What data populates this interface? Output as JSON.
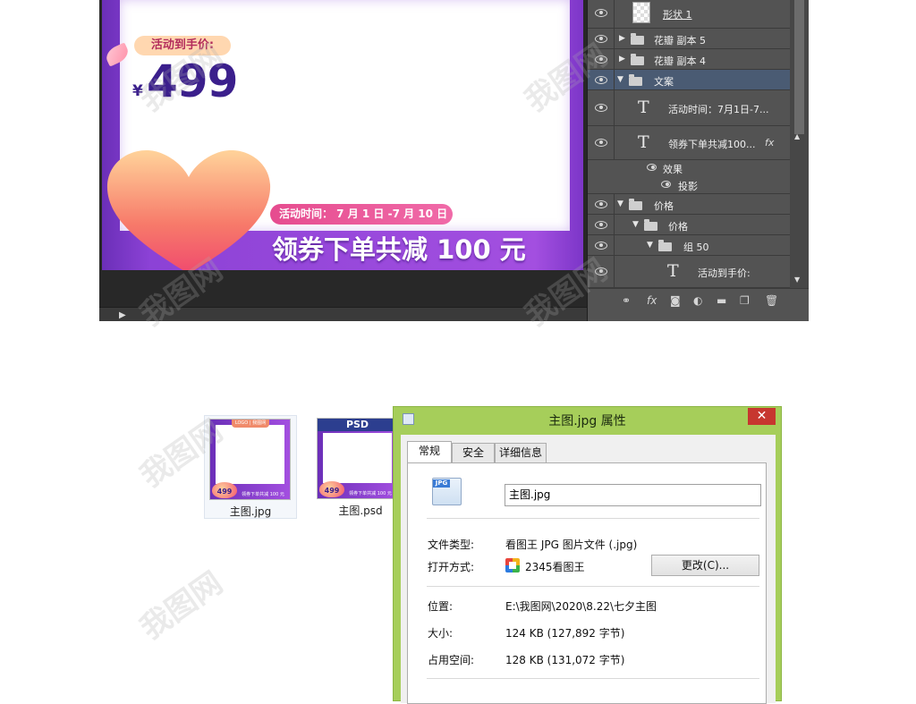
{
  "photoshop": {
    "poster": {
      "heart_label": "活动到手价:",
      "currency": "¥",
      "price": "499",
      "date_text": "活动时间：  7 月 1 日 -7 月 10 日",
      "coupon_text": "领券下单共减 100 元"
    },
    "layers": [
      {
        "name": "形状 1",
        "kind": "shape"
      },
      {
        "name": "花瓣 副本 5",
        "kind": "folder"
      },
      {
        "name": "花瓣 副本 4",
        "kind": "folder"
      },
      {
        "name": "文案",
        "kind": "folder-open",
        "selected": true
      },
      {
        "name": "活动时间：7月1日-7...",
        "kind": "text"
      },
      {
        "name": "领券下单共减100...",
        "kind": "text",
        "fx": "fx"
      },
      {
        "name": "效果",
        "kind": "effect"
      },
      {
        "name": "投影",
        "kind": "effect-sub"
      },
      {
        "name": "价格",
        "kind": "folder-open"
      },
      {
        "name": "价格",
        "kind": "folder-open"
      },
      {
        "name": "组 50",
        "kind": "folder-open"
      },
      {
        "name": "活动到手价:",
        "kind": "text"
      }
    ],
    "toolbar_icons": [
      "link-icon",
      "fx-icon",
      "mask-icon",
      "adjustment-icon",
      "group-icon",
      "new-layer-icon",
      "trash-icon"
    ]
  },
  "thumbnails": [
    {
      "label": "主图.jpg",
      "logo": "LOGO | 我图网",
      "price": "499",
      "band": "领券下单共减 100 元"
    },
    {
      "label": "主图.psd",
      "tag": "PSD",
      "price": "499",
      "band": "领券下单共减 100 元"
    }
  ],
  "dialog": {
    "title": "主图.jpg 属性",
    "close": "✕",
    "tabs": [
      "常规",
      "安全",
      "详细信息"
    ],
    "file_icon_tag": "JPG",
    "filename": "主图.jpg",
    "rows": {
      "type_label": "文件类型:",
      "type_value": "看图王 JPG 图片文件 (.jpg)",
      "open_label": "打开方式:",
      "open_value": "2345看图王",
      "change_button": "更改(C)...",
      "location_label": "位置:",
      "location_value": "E:\\我图网\\2020\\8.22\\七夕主图",
      "size_label": "大小:",
      "size_value": "124 KB (127,892 字节)",
      "disk_label": "占用空间:",
      "disk_value": "128 KB (131,072 字节)"
    }
  },
  "watermark": "我图网"
}
